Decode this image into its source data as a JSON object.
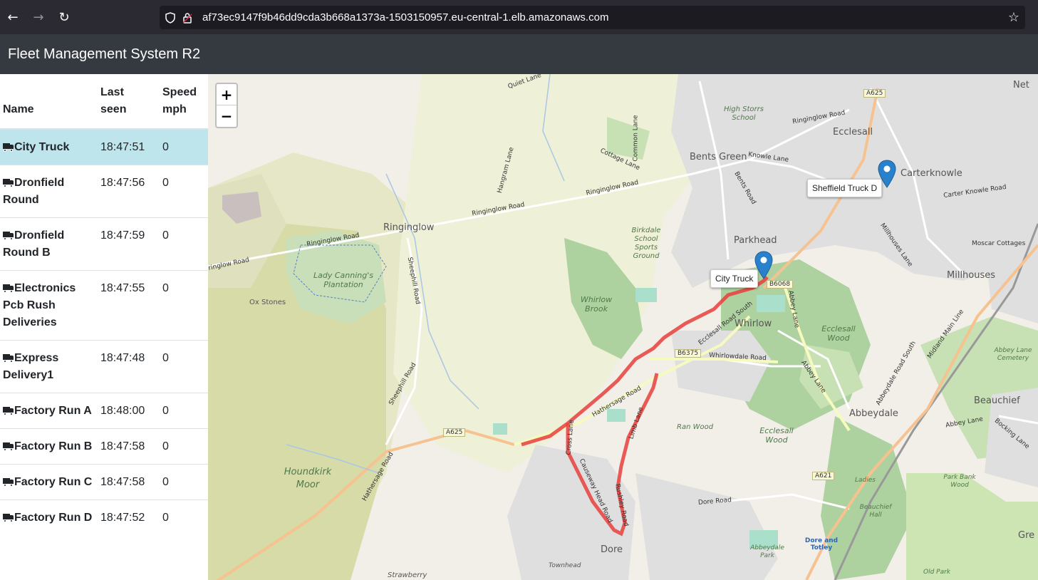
{
  "browser": {
    "url": "af73ec9147f9b46dd9cda3b668a1373a-1503150957.eu-central-1.elb.amazonaws.com"
  },
  "app": {
    "title": "Fleet Management System R2"
  },
  "table": {
    "headers": {
      "name": "Name",
      "last_seen_1": "Last",
      "last_seen_2": "seen",
      "speed_1": "Speed",
      "speed_2": "mph"
    },
    "rows": [
      {
        "name": "City Truck",
        "last_seen": "18:47:51",
        "speed": "0"
      },
      {
        "name": "Dronfield Round",
        "last_seen": "18:47:56",
        "speed": "0"
      },
      {
        "name": "Dronfield Round B",
        "last_seen": "18:47:59",
        "speed": "0"
      },
      {
        "name": "Electronics Pcb Rush Deliveries",
        "last_seen": "18:47:55",
        "speed": "0"
      },
      {
        "name": "Express Delivery1",
        "last_seen": "18:47:48",
        "speed": "0"
      },
      {
        "name": "Factory Run A",
        "last_seen": "18:48:00",
        "speed": "0"
      },
      {
        "name": "Factory Run B",
        "last_seen": "18:47:58",
        "speed": "0"
      },
      {
        "name": "Factory Run C",
        "last_seen": "18:47:58",
        "speed": "0"
      },
      {
        "name": "Factory Run D",
        "last_seen": "18:47:52",
        "speed": "0"
      }
    ]
  },
  "map": {
    "zoom_in": "+",
    "zoom_out": "−",
    "markers": {
      "city_truck": "City Truck",
      "sheffield_truck": "Sheffield Truck D"
    },
    "places": {
      "ecclesall": "Ecclesall",
      "bents_green": "Bents Green",
      "carterknowle": "Carterknowle",
      "parkhead": "Parkhead",
      "ringinglow": "Ringinglow",
      "millhouses": "Millhouses",
      "whirlow": "Whirlow",
      "abbeydale": "Abbeydale",
      "beauchief": "Beauchief",
      "dore": "Dore",
      "ox_stones": "Ox Stones",
      "net": "Net",
      "gre": "Gre"
    },
    "green_labels": {
      "lady_cannings": "Lady Canning's Plantation",
      "houndkirk": "Houndkirk Moor",
      "whirlow_brook": "Whirlow Brook",
      "birkdale": "Birkdale School Sports Ground",
      "ecclesall_wood_n": "Ecclesall Wood",
      "ecclesall_wood_s": "Ecclesall Wood",
      "high_storrs": "High Storrs School",
      "abbey_lane_cemetery": "Abbey Lane Cemetery",
      "ran_wood": "Ran Wood",
      "park_bank_wood": "Park Bank Wood",
      "beauchief_hall": "Beauchief Hall",
      "abbeydale_park": "Abbeydale Park",
      "ladies": "Ladies",
      "townhead": "Townhead",
      "strawberry": "Strawberry",
      "old_park": "Old Park"
    },
    "road_labels": {
      "ringinglow_road_1": "Ringinglow Road",
      "ringinglow_road_2": "Ringinglow Road",
      "ringinglow_road_3": "Ringinglow Road",
      "ringinglow_road_4": "Ringinglow Road",
      "ringinglow_road_5": "ringlow Road",
      "cottage_lane": "Cottage Lane",
      "common_lane": "Common Lane",
      "hangram_lane": "Hangram Lane",
      "sheephill_road_1": "Sheephill Road",
      "sheephill_road_2": "Sheephill Road",
      "hathersage_road_1": "Hathersage Road",
      "hathersage_road_2": "Hathersage Road",
      "ecclesall_road_south": "Ecclesall Road South",
      "whirlowdale_road": "Whirlowdale Road",
      "abbey_lane_1": "Abbey Lane",
      "abbey_lane_2": "Abbey Lane",
      "abbey_lane_3": "Abbey Lane",
      "abbeydale_road_south": "Abbeydale Road South",
      "limb_lane": "Limb Lane",
      "cross_lane": "Cross Lane",
      "causeway_head_road": "Causeway Head Road",
      "rushley_road": "Rushley Road",
      "dore_road": "Dore Road",
      "knowle_lane": "Knowle Lane",
      "bents_road": "Bents Road",
      "carter_knowle_road": "Carter Knowle Road",
      "millhouses_lane": "Millhouses Lane",
      "moscar_cottages": "Moscar Cottages",
      "midland_main_line": "Midland Main Line",
      "bocking_lane": "Bocking Lane",
      "quiet_lane": "Quiet Lane",
      "dore_and_totley": "Dore and Totley"
    },
    "shields": {
      "a625_top": "A625",
      "b6068": "B6068",
      "b6375": "B6375",
      "a625_left": "A625",
      "a621": "A621"
    }
  },
  "colors": {
    "navbar": "#343a40",
    "selected_row": "#bee5eb",
    "route": "#e8403c",
    "marker": "#2a81cb"
  }
}
